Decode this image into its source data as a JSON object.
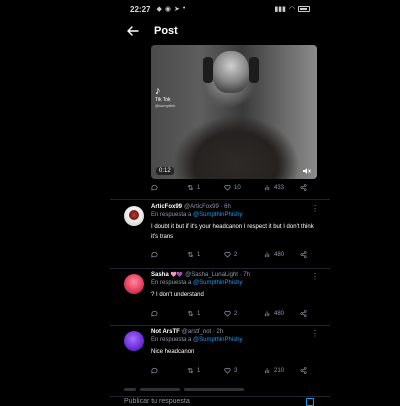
{
  "status": {
    "time": "22:27",
    "left_icons": [
      "bell",
      "whatsapp",
      "send",
      "dot"
    ],
    "right_icons": [
      "wifi",
      "signal",
      "battery"
    ]
  },
  "header": {
    "title": "Post"
  },
  "media": {
    "tiktok_user": "Tik Tok",
    "tiktok_handle": "@sumpthin",
    "duration": "0:12"
  },
  "post_actions": {
    "retweets": "1",
    "likes": "10",
    "views": "433"
  },
  "replies": [
    {
      "name": "ArticFox99",
      "meta": "@ArticFox99 · 6h",
      "replying_prefix": "En respuesta a",
      "mention": "@SumpthinPhishy",
      "text": "I doubt it but if it's your headcanon I respect it but I don't think it's trans",
      "retweets": "1",
      "likes": "2",
      "views": "480"
    },
    {
      "name": "Sasha",
      "badges": "🩷💜",
      "meta": "@Sasha_LunaLight · 7h",
      "replying_prefix": "En respuesta a",
      "mention": "@SumpthinPhishy",
      "text": "? I don't understand",
      "retweets": "1",
      "likes": "2",
      "views": "480"
    },
    {
      "name": "Not ArsTF",
      "meta": "@arstf_not · 2h",
      "replying_prefix": "En respuesta a",
      "mention": "@SumpthinPhishy",
      "text": "Nice headcanon",
      "retweets": "1",
      "likes": "3",
      "views": "210"
    }
  ],
  "composer": {
    "placeholder": "Publicar tu respuesta"
  },
  "colors": {
    "accent": "#1d9bf0",
    "muted": "#8b98a5",
    "bg": "#000000"
  }
}
